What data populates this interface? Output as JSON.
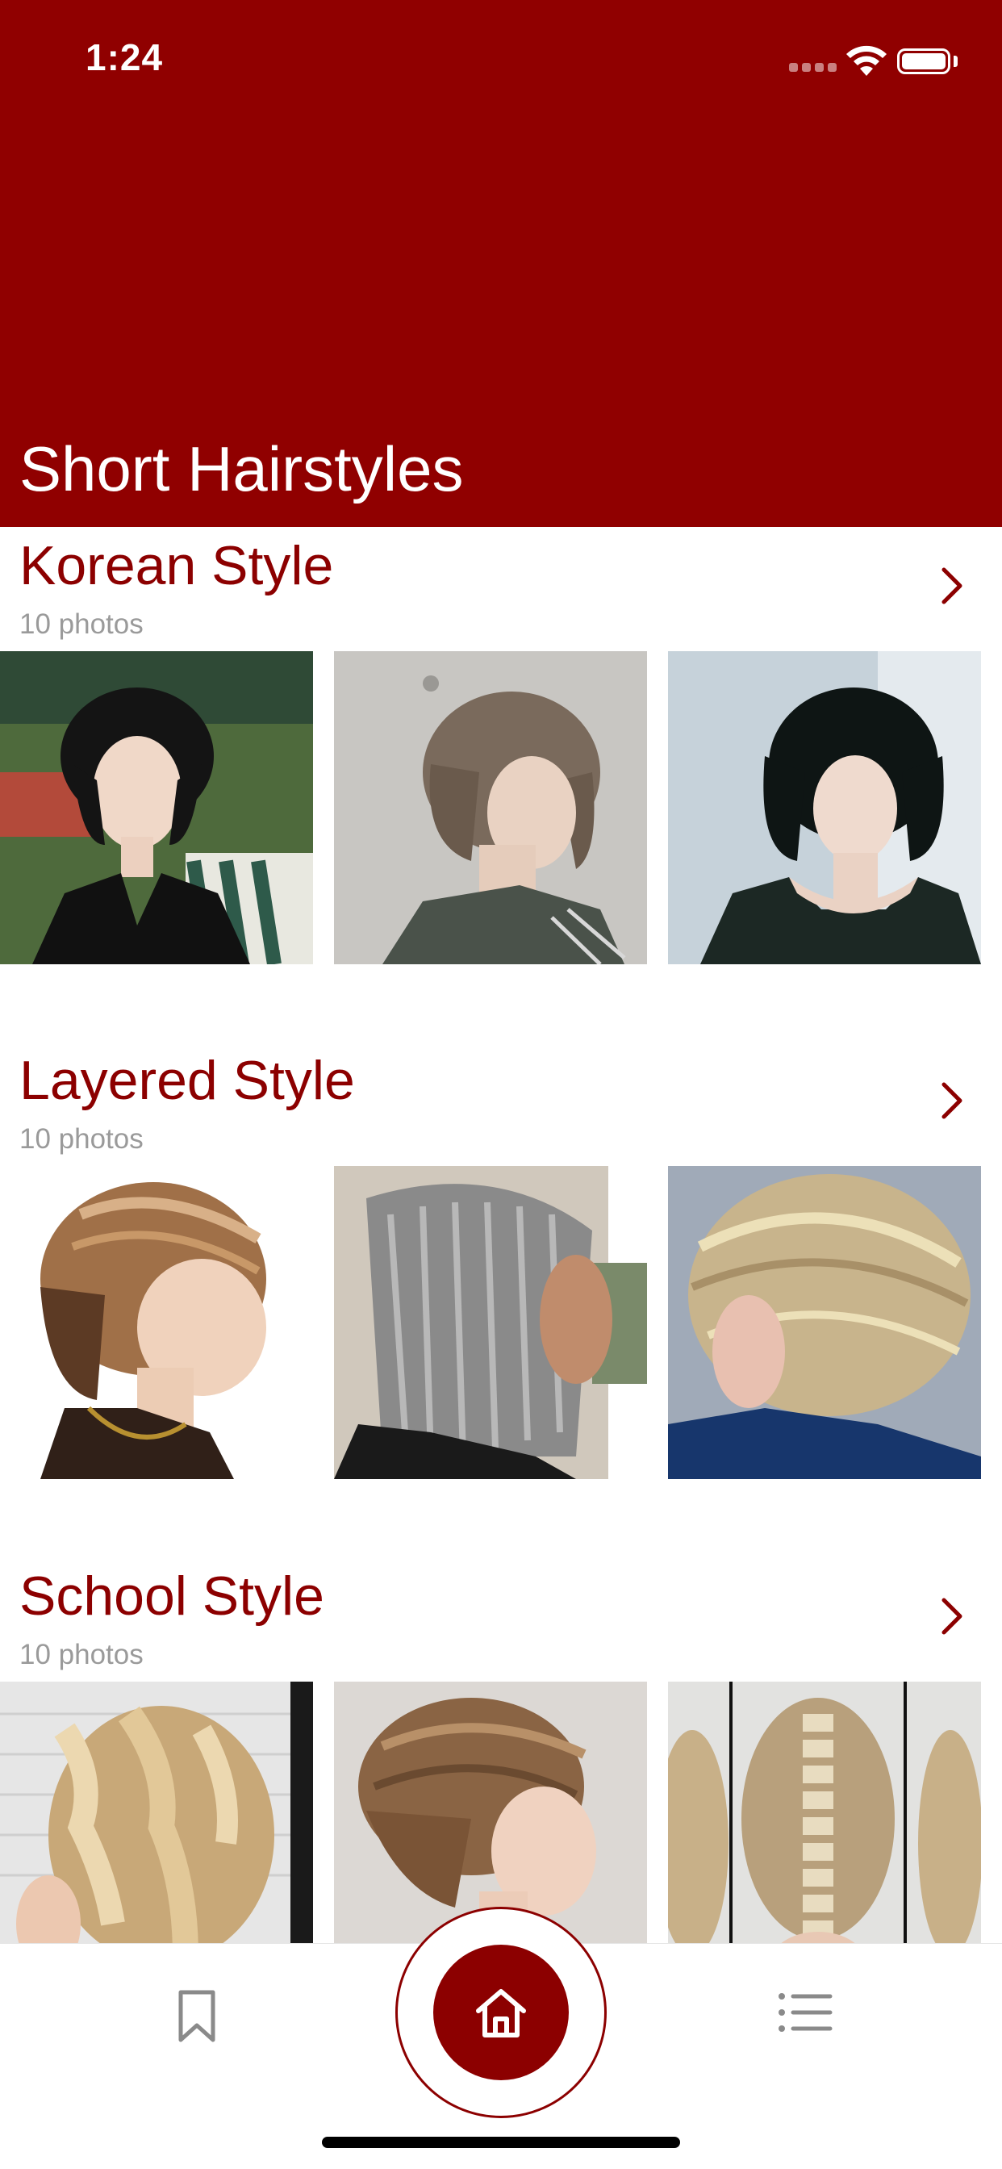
{
  "status_bar": {
    "time": "1:24"
  },
  "header": {
    "title": "Short Hairstyles"
  },
  "sections": [
    {
      "title": "Korean Style",
      "count": "10 photos"
    },
    {
      "title": "Layered Style",
      "count": "10 photos"
    },
    {
      "title": "School Style",
      "count": "10 photos"
    }
  ],
  "tab_bar": {
    "left_icon": "bookmark-icon",
    "center_icon": "home-icon",
    "right_icon": "list-icon"
  },
  "colors": {
    "brand": "#900000",
    "accent_text": "#8c0000",
    "muted_text": "#9a9a9a"
  }
}
